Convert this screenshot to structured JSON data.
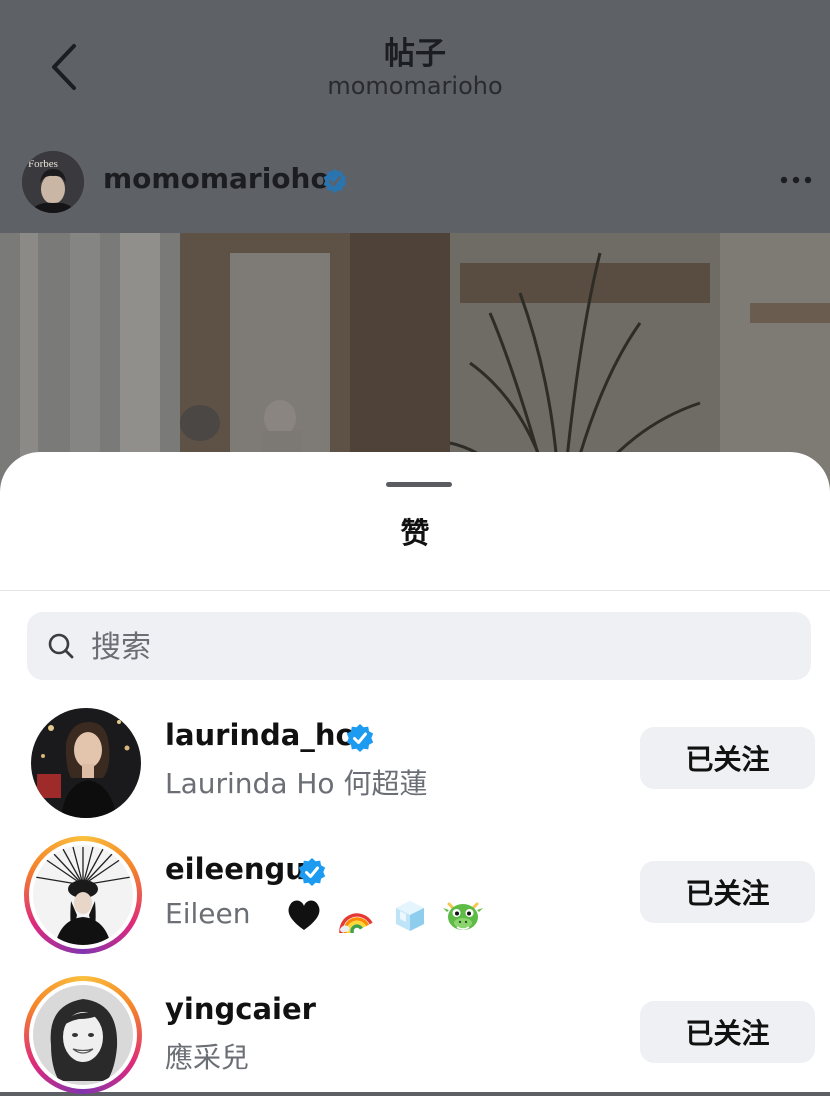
{
  "nav": {
    "title": "帖子",
    "subtitle": "momomarioho"
  },
  "author": {
    "username": "momomarioho",
    "avatar_text": "Forbes",
    "verified": true
  },
  "sheet": {
    "title": "赞",
    "search_placeholder": "搜索",
    "users": [
      {
        "username": "laurinda_ho",
        "full_name": "Laurinda Ho 何超蓮",
        "verified": true,
        "story_ring": false,
        "button": "已关注"
      },
      {
        "username": "eileengu",
        "full_name": "Eileen",
        "full_name_emoji": [
          "black-heart",
          "rainbow",
          "ice-cube",
          "dragon-face"
        ],
        "verified": true,
        "story_ring": true,
        "button": "已关注"
      },
      {
        "username": "yingcaier",
        "full_name": "應采兒",
        "verified": false,
        "story_ring": true,
        "button": "已关注"
      }
    ]
  },
  "colors": {
    "verified_blue": "#1d9bf0",
    "button_bg": "#eef0f3",
    "secondary_text": "#6b6e74"
  }
}
